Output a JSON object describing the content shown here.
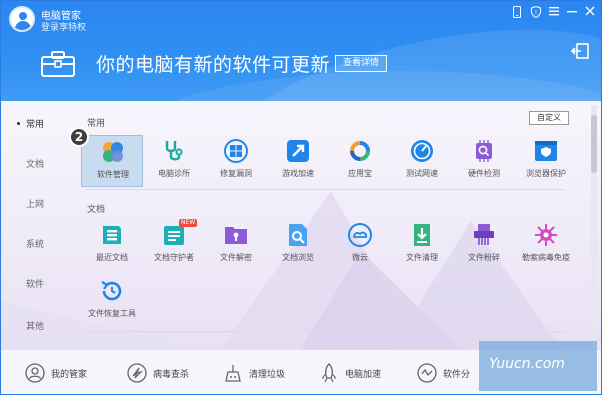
{
  "header": {
    "app_title": "电脑管家",
    "login_link": "登录享特权",
    "headline": "你的电脑有新的软件可更新",
    "details_button": "查看详情",
    "window_controls": [
      "phone-icon",
      "shield-icon",
      "menu-icon",
      "minimize-icon",
      "close-icon"
    ]
  },
  "sidebar": {
    "items": [
      {
        "label": "常用",
        "active": true
      },
      {
        "label": "文档",
        "active": false
      },
      {
        "label": "上网",
        "active": false
      },
      {
        "label": "系统",
        "active": false
      },
      {
        "label": "软件",
        "active": false
      },
      {
        "label": "其他",
        "active": false
      }
    ]
  },
  "main": {
    "customize_button": "自定义",
    "badge_number": "2",
    "sections": [
      {
        "title": "常用",
        "tools": [
          {
            "label": "软件管理",
            "icon": "software-manager-icon",
            "selected": true
          },
          {
            "label": "电脑诊所",
            "icon": "stethoscope-icon"
          },
          {
            "label": "修复漏洞",
            "icon": "windows-repair-icon"
          },
          {
            "label": "游戏加速",
            "icon": "game-boost-icon"
          },
          {
            "label": "应用宝",
            "icon": "app-store-icon"
          },
          {
            "label": "测试网速",
            "icon": "speed-test-icon"
          },
          {
            "label": "硬件检测",
            "icon": "hardware-check-icon"
          },
          {
            "label": "浏览器保护",
            "icon": "browser-protect-icon"
          }
        ]
      },
      {
        "title": "文档",
        "tools": [
          {
            "label": "最近文档",
            "icon": "recent-docs-icon"
          },
          {
            "label": "文档守护者",
            "icon": "doc-guardian-icon",
            "tag": "NEW"
          },
          {
            "label": "文件解密",
            "icon": "file-decrypt-icon"
          },
          {
            "label": "文档浏览",
            "icon": "doc-browse-icon"
          },
          {
            "label": "微云",
            "icon": "weiyun-icon"
          },
          {
            "label": "文件清理",
            "icon": "file-clean-icon"
          },
          {
            "label": "文件粉碎",
            "icon": "file-shred-icon"
          },
          {
            "label": "勒索病毒免疫",
            "icon": "ransomware-immune-icon"
          },
          {
            "label": "文件恢复工具",
            "icon": "file-recovery-icon"
          }
        ]
      }
    ]
  },
  "bottom_bar": {
    "items": [
      {
        "label": "我的管家",
        "icon": "my-manager-icon"
      },
      {
        "label": "病毒查杀",
        "icon": "virus-scan-icon"
      },
      {
        "label": "清理垃圾",
        "icon": "clean-junk-icon"
      },
      {
        "label": "电脑加速",
        "icon": "rocket-icon"
      },
      {
        "label": "软件分",
        "icon": "software-icon"
      }
    ]
  },
  "watermark": "Yuucn.com",
  "colors": {
    "header_blue": "#2b86f0",
    "accent_blue": "#1f86e8",
    "content_bg": "#f2eff9"
  }
}
